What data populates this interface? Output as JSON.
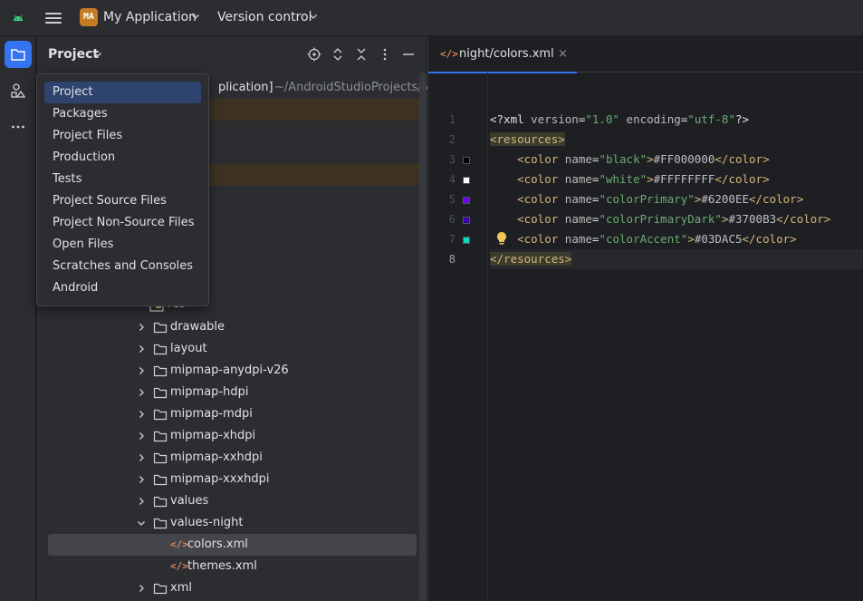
{
  "titlebar": {
    "project_badge": "MA",
    "project_name": "My Application",
    "vcs_label": "Version control"
  },
  "project_panel": {
    "title": "Project",
    "tree": [
      {
        "label": "[My Application]",
        "path": " ~/AndroidStudioProjects/My",
        "visible_fragment": "plication]"
      },
      {
        "label": "res",
        "indent": 4,
        "expanded": true
      },
      {
        "label": "drawable",
        "indent": 5
      },
      {
        "label": "layout",
        "indent": 5
      },
      {
        "label": "mipmap-anydpi-v26",
        "indent": 5
      },
      {
        "label": "mipmap-hdpi",
        "indent": 5
      },
      {
        "label": "mipmap-mdpi",
        "indent": 5
      },
      {
        "label": "mipmap-xhdpi",
        "indent": 5
      },
      {
        "label": "mipmap-xxhdpi",
        "indent": 5
      },
      {
        "label": "mipmap-xxxhdpi",
        "indent": 5
      },
      {
        "label": "values",
        "indent": 5
      },
      {
        "label": "values-night",
        "indent": 5,
        "expanded": true
      },
      {
        "label": "colors.xml",
        "indent": 6,
        "selected": true
      },
      {
        "label": "themes.xml",
        "indent": 6
      },
      {
        "label": "xml",
        "indent": 5
      }
    ]
  },
  "view_menu": {
    "items": [
      {
        "label": "Project",
        "selected": true
      },
      {
        "label": "Packages"
      },
      {
        "label": "Project Files"
      },
      {
        "label": "Production"
      },
      {
        "label": "Tests"
      },
      {
        "label": "Project Source Files"
      },
      {
        "label": "Project Non-Source Files"
      },
      {
        "label": "Open Files"
      },
      {
        "label": "Scratches and Consoles"
      },
      {
        "label": "Android"
      }
    ]
  },
  "editor": {
    "tab_label": "night/colors.xml",
    "tab_close": "×",
    "current_line": 8,
    "lines": [
      {
        "n": "1",
        "text": "<?xml version=\"1.0\" encoding=\"utf-8\"?>"
      },
      {
        "n": "2",
        "text": "<resources>"
      },
      {
        "n": "3",
        "text": "    <color name=\"black\">#FF000000</color>",
        "swatch": "#000000"
      },
      {
        "n": "4",
        "text": "    <color name=\"white\">#FFFFFFFF</color>",
        "swatch": "#FFFFFF"
      },
      {
        "n": "5",
        "text": "    <color name=\"colorPrimary\">#6200EE</color>",
        "swatch": "#6200EE"
      },
      {
        "n": "6",
        "text": "    <color name=\"colorPrimaryDark\">#3700B3</color>",
        "swatch": "#3700B3"
      },
      {
        "n": "7",
        "text": "    <color name=\"colorAccent\">#03DAC5</color>",
        "swatch": "#03DAC5"
      },
      {
        "n": "8",
        "text": "</resources>"
      }
    ]
  },
  "colors": {
    "accent": "#3574f0",
    "panel_bg": "#2b2d30",
    "editor_bg": "#1e1f22",
    "badge": "#c57b21"
  },
  "icons": {
    "toolstripe": [
      "folder-icon",
      "structure-icon",
      "more-icon"
    ],
    "panel_header": [
      "locate-icon",
      "expand-all-icon",
      "collapse-all-icon",
      "options-icon",
      "hide-icon"
    ]
  }
}
